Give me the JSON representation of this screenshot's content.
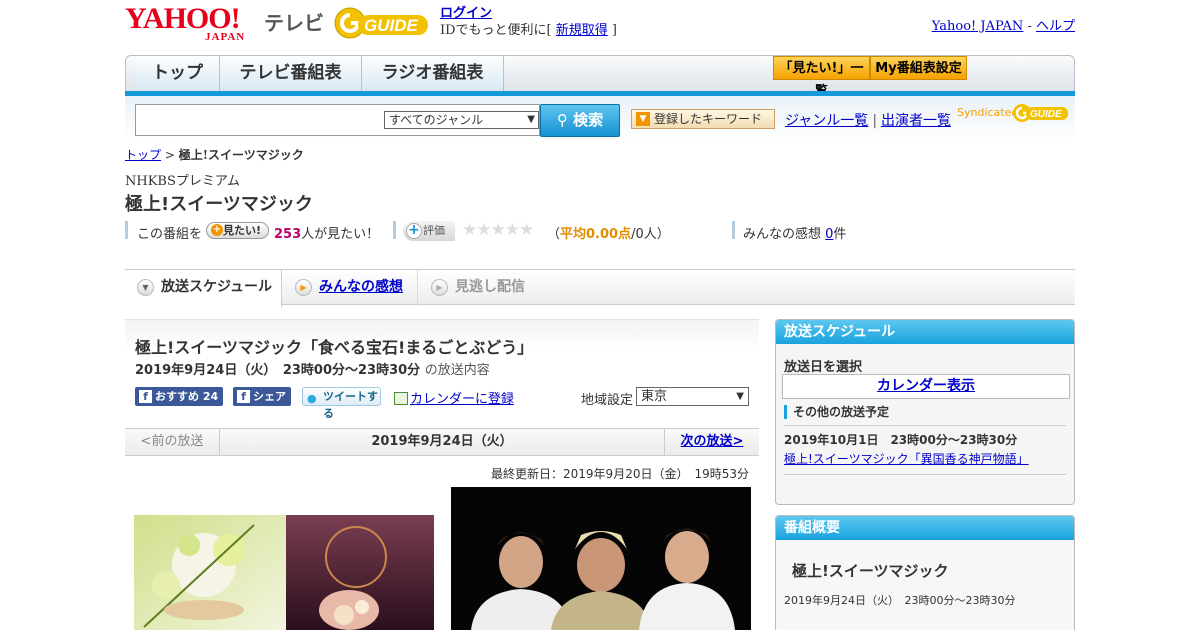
{
  "header": {
    "yahoo_logo_text": "YAHOO!",
    "yahoo_logo_sub": "JAPAN",
    "tv_label": "テレビ",
    "gguide_text": "GUIDE",
    "login_label": "ログイン",
    "login_prompt": "IDでもっと便利に[ ",
    "signup_label": "新規取得",
    "login_prompt_end": " ]",
    "yahoo_japan_link": "Yahoo! JAPAN",
    "sep": " - ",
    "help_link": "ヘルプ"
  },
  "nav": {
    "tabs": [
      {
        "label": "トップ"
      },
      {
        "label": "テレビ番組表"
      },
      {
        "label": "ラジオ番組表"
      }
    ],
    "mitai_list": "「見たい!」一覧",
    "my_schedule": "My番組表設定"
  },
  "search": {
    "input_value": "",
    "genre_selected": "すべてのジャンル",
    "button_label": "検索",
    "keyword_button": "登録したキーワード",
    "genre_list_link": "ジャンル一覧",
    "performer_list_link": "出演者一覧",
    "syndicated": "Syndicated",
    "syndicated_brand": "GUIDE"
  },
  "breadcrumb": {
    "home": "トップ",
    "sep": " > ",
    "current": "極上!スイーツマジック"
  },
  "program": {
    "channel": "NHKBSプレミアム",
    "title": "極上!スイーツマジック"
  },
  "stats": {
    "prefix": "この番組を",
    "mitai_button": "見たい!",
    "mitai_count": "253",
    "mitai_suffix": "人が見たい！",
    "rate_button": "評価",
    "stars": "★★★★★",
    "rating_open": "（",
    "rating_avg": "平均0.00点",
    "rating_people": "/0人）",
    "impressions_prefix": "みんなの感想 ",
    "impressions_count": "0",
    "impressions_suffix": "件"
  },
  "content_tabs": {
    "schedule": "放送スケジュール",
    "impressions": "みんなの感想",
    "streaming": "見逃し配信"
  },
  "episode": {
    "title": "極上!スイーツマジック「食べる宝石!まるごとぶどう」",
    "datetime": "2019年9月24日（火）　23時00分～23時30分",
    "datetime_suffix": "の放送内容",
    "fb_recommend": "おすすめ 24",
    "fb_share": "シェア",
    "tweet": "ツイートする",
    "calendar_link": "カレンダーに登録",
    "region_label": "地域設定",
    "region_selected": "東京"
  },
  "pager": {
    "prev": "<前の放送",
    "current": "2019年9月24日（火）",
    "next": "次の放送>"
  },
  "last_updated": "最終更新日：2019年9月20日（金）　19時53分",
  "sidebar": {
    "schedule_head": "放送スケジュール",
    "date_select_label": "放送日を選択",
    "calendar_button": "カレンダー表示",
    "other_label": "その他の放送予定",
    "other_datetime": "2019年10月1日　23時00分～23時30分",
    "other_title": "極上!スイーツマジック「異国香る神戸物語」",
    "overview_head": "番組概要",
    "overview_title": "極上!スイーツマジック",
    "overview_datetime": "2019年9月24日（火）　23時00分～23時30分"
  },
  "colors": {
    "yahoo_red": "#e6001b",
    "accent_blue": "#1599d8",
    "link_blue": "#0000cc",
    "orange": "#f29400",
    "magenta": "#c0006a"
  }
}
